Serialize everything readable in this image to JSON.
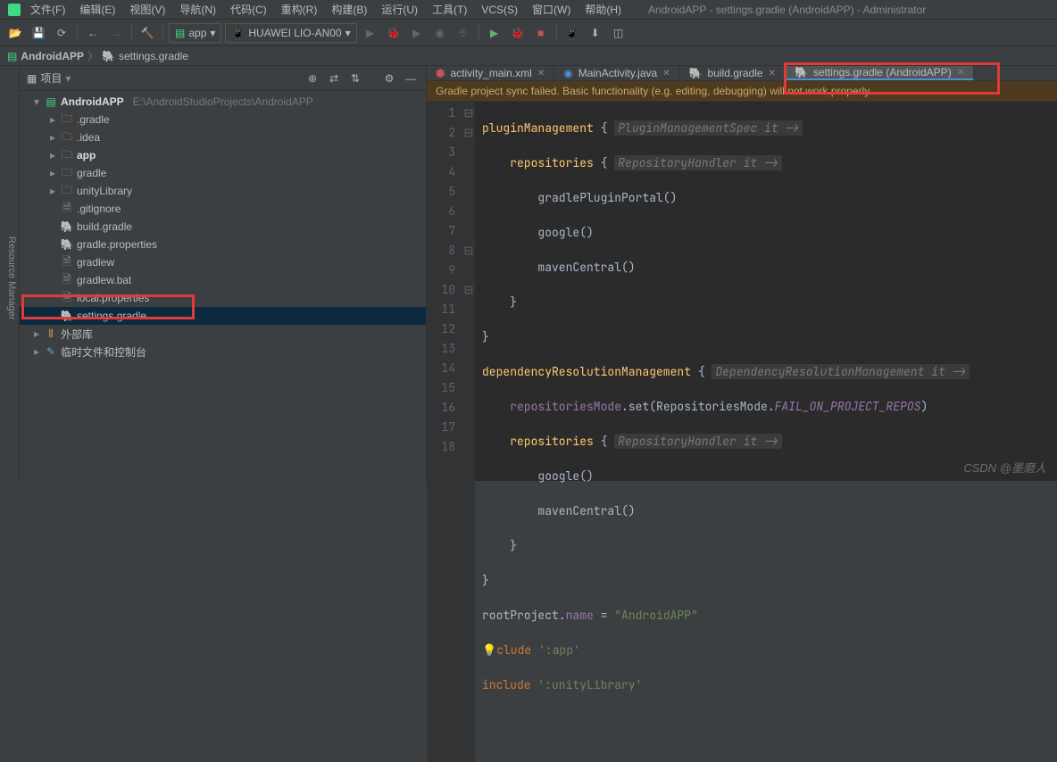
{
  "window_title": "AndroidAPP - settings.gradle (AndroidAPP) - Administrator",
  "menubar": [
    "文件(F)",
    "编辑(E)",
    "视图(V)",
    "导航(N)",
    "代码(C)",
    "重构(R)",
    "构建(B)",
    "运行(U)",
    "工具(T)",
    "VCS(S)",
    "窗口(W)",
    "帮助(H)"
  ],
  "toolbar": {
    "run_config": "app",
    "device": "HUAWEI LIO-AN00"
  },
  "breadcrumb": {
    "project": "AndroidAPP",
    "file": "settings.gradle"
  },
  "left_gutter": [
    "Resource Manager",
    "项目"
  ],
  "panel": {
    "title": "项目",
    "tree": [
      {
        "depth": 0,
        "exp": "open",
        "icon": "project",
        "label": "AndroidAPP",
        "bold": true,
        "hint": "E:\\AndroidStudioProjects\\AndroidAPP"
      },
      {
        "depth": 1,
        "exp": "closed",
        "icon": "folder-orange",
        "label": ".gradle"
      },
      {
        "depth": 1,
        "exp": "closed",
        "icon": "folder-orange",
        "label": ".idea"
      },
      {
        "depth": 1,
        "exp": "closed",
        "icon": "folder",
        "label": "app",
        "bold": true
      },
      {
        "depth": 1,
        "exp": "closed",
        "icon": "folder",
        "label": "gradle"
      },
      {
        "depth": 1,
        "exp": "closed",
        "icon": "folder",
        "label": "unityLibrary"
      },
      {
        "depth": 1,
        "exp": "none",
        "icon": "file",
        "label": ".gitignore"
      },
      {
        "depth": 1,
        "exp": "none",
        "icon": "gradle",
        "label": "build.gradle"
      },
      {
        "depth": 1,
        "exp": "none",
        "icon": "gradle",
        "label": "gradle.properties"
      },
      {
        "depth": 1,
        "exp": "none",
        "icon": "file",
        "label": "gradlew"
      },
      {
        "depth": 1,
        "exp": "none",
        "icon": "file",
        "label": "gradlew.bat"
      },
      {
        "depth": 1,
        "exp": "none",
        "icon": "file",
        "label": "local.properties"
      },
      {
        "depth": 1,
        "exp": "none",
        "icon": "gradle",
        "label": "settings.gradle",
        "selected": true
      },
      {
        "depth": 0,
        "exp": "closed",
        "icon": "lib",
        "label": "外部库"
      },
      {
        "depth": 0,
        "exp": "closed",
        "icon": "scratch",
        "label": "临时文件和控制台"
      }
    ]
  },
  "tabs": [
    {
      "icon": "xml",
      "label": "activity_main.xml"
    },
    {
      "icon": "java",
      "label": "MainActivity.java"
    },
    {
      "icon": "gradle",
      "label": "build.gradle"
    },
    {
      "icon": "gradle",
      "label": "settings.gradle (AndroidAPP)",
      "active": true
    }
  ],
  "warning": "Gradle project sync failed. Basic functionality (e.g. editing, debugging) will not work properly.",
  "code": {
    "numbers": [
      "1",
      "2",
      "3",
      "4",
      "5",
      "6",
      "7",
      "8",
      "9",
      "10",
      "11",
      "12",
      "13",
      "14",
      "15",
      "16",
      "17",
      "18"
    ],
    "folds": [
      "⊟",
      "⊟",
      "",
      "",
      "",
      "",
      "",
      "⊟",
      "",
      "⊟",
      "",
      "",
      "",
      "",
      "",
      "",
      "",
      ""
    ],
    "hint1": "PluginManagementSpec it ->",
    "hint2": "RepositoryHandler it ->",
    "hint3": "DependencyResolutionManagement it ->",
    "hint4": "RepositoryHandler it ->",
    "l1a": "pluginManagement ",
    "l1b": "{",
    "l2a": "    repositories ",
    "l2b": "{",
    "l3": "        gradlePluginPortal()",
    "l4": "        google()",
    "l5": "        mavenCentral()",
    "l6": "    }",
    "l7": "}",
    "l8a": "dependencyResolutionManagement ",
    "l8b": "{",
    "l9a": "    ",
    "l9b": "repositoriesMode",
    "l9c": ".set(RepositoriesMode.",
    "l9d": "FAIL_ON_PROJECT_REPOS",
    "l9e": ")",
    "l10a": "    repositories ",
    "l10b": "{",
    "l11": "        google()",
    "l12": "        mavenCentral()",
    "l13": "    }",
    "l14": "}",
    "l15a": "rootProject.",
    "l15b": "name",
    "l15c": " = ",
    "l15d": "\"AndroidAPP\"",
    "l16a": "include ",
    "l16b": "':app'",
    "l17a": "include ",
    "l17b": "':unityLibrary'"
  },
  "watermark": "CSDN @墨磨人"
}
